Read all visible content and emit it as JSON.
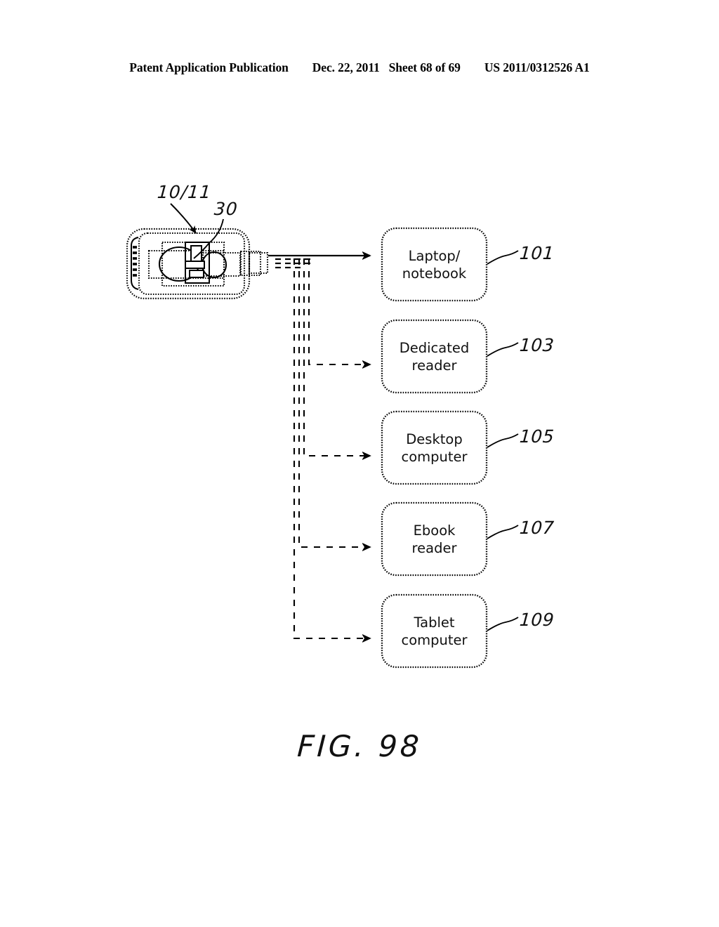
{
  "header": {
    "publication": "Patent Application Publication",
    "date": "Dec. 22, 2011",
    "sheet": "Sheet 68 of 69",
    "patent_number": "US 2011/0312526 A1"
  },
  "figure": {
    "caption": "FIG. 98",
    "source_device": {
      "ref_label": "10/11",
      "component_ref_label": "30",
      "name": "handheld-device"
    },
    "targets": [
      {
        "label": "Laptop/\nnotebook",
        "ref": "101",
        "arrow": "solid"
      },
      {
        "label": "Dedicated\nreader",
        "ref": "103",
        "arrow": "dashed"
      },
      {
        "label": "Desktop\ncomputer",
        "ref": "105",
        "arrow": "dashed"
      },
      {
        "label": "Ebook\nreader",
        "ref": "107",
        "arrow": "dashed"
      },
      {
        "label": "Tablet\ncomputer",
        "ref": "109",
        "arrow": "dashed"
      }
    ]
  },
  "colors": {
    "ink": "#000000",
    "paper": "#ffffff"
  }
}
